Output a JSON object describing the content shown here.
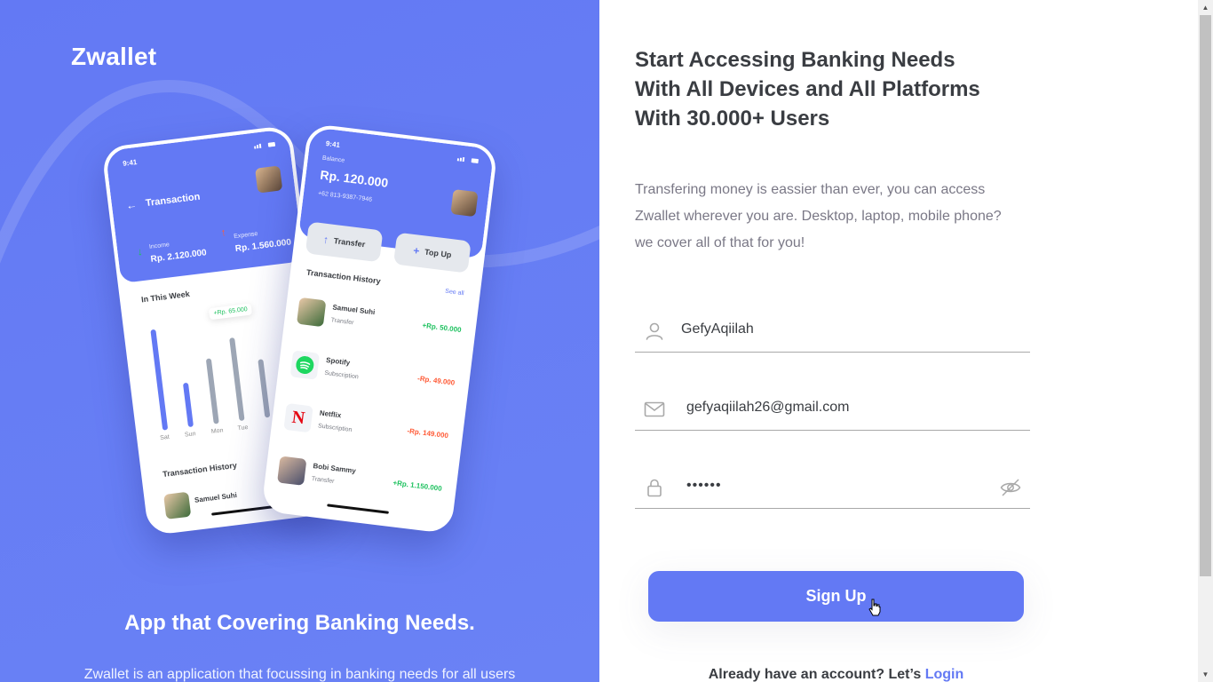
{
  "brand": {
    "name": "Zwallet"
  },
  "left": {
    "title": "App that Covering Banking Needs.",
    "description": "Zwallet is an application that focussing in banking needs for all users"
  },
  "phone_a": {
    "time": "9:41",
    "title": "Transaction",
    "income_label": "Income",
    "income_value": "Rp. 2.120.000",
    "expense_label": "Expense",
    "expense_value": "Rp. 1.560.000",
    "week_title": "In This Week",
    "pill": "+Rp. 65.000",
    "days": [
      "Sat",
      "Sun",
      "Mon",
      "Tue"
    ],
    "bars": [
      {
        "level": 0.95,
        "color": "#6379F4"
      },
      {
        "level": 0.42,
        "color": "#6379F4"
      },
      {
        "level": 0.62,
        "color": "#9da6b5"
      },
      {
        "level": 0.78,
        "color": "#9da6b5"
      },
      {
        "level": 0.55,
        "color": "#9da6b5"
      }
    ],
    "history_title": "Transaction History",
    "history_user": "Samuel Suhi"
  },
  "phone_b": {
    "time": "9:41",
    "balance_label": "Balance",
    "balance_value": "Rp. 120.000",
    "phone_number": "+62 813-9387-7946",
    "transfer_label": "Transfer",
    "topup_label": "Top Up",
    "history_title": "Transaction History",
    "see_all": "See all",
    "transactions": [
      {
        "name": "Samuel Suhi",
        "type": "Transfer",
        "amount": "+Rp. 50.000",
        "color": "#1EC15F",
        "icon": "avatar"
      },
      {
        "name": "Spotify",
        "type": "Subscription",
        "amount": "-Rp. 49.000",
        "color": "#FF5B37",
        "icon": "spotify-logo"
      },
      {
        "name": "Netflix",
        "type": "Subscription",
        "amount": "-Rp. 149.000",
        "color": "#FF5B37",
        "icon": "netflix-logo"
      },
      {
        "name": "Bobi Sammy",
        "type": "Transfer",
        "amount": "+Rp. 1.150.000",
        "color": "#1EC15F",
        "icon": "avatar"
      }
    ]
  },
  "right": {
    "headline": [
      "Start Accessing Banking Needs",
      "With All Devices and All Platforms",
      "With 30.000+ Users"
    ],
    "subcopy": "Transfering money is eassier than ever, you can access Zwallet wherever you are. Desktop, laptop, mobile phone? we cover all of that for you!",
    "username": "GefyAqiilah",
    "email": "gefyaqiilah26@gmail.com",
    "password_masked": "••••••",
    "signup_label": "Sign Up",
    "login_prompt": "Already have an account? Let’s ",
    "login_link": "Login"
  },
  "colors": {
    "primary": "#6379F4",
    "text_dark": "#3a3d42",
    "text_muted": "#7a7886",
    "income": "#1EC15F",
    "expense": "#FF5B37"
  },
  "icons": {
    "username": "user-icon",
    "email": "mail-icon",
    "password": "lock-icon",
    "visibility": "eye-crossed-icon"
  }
}
